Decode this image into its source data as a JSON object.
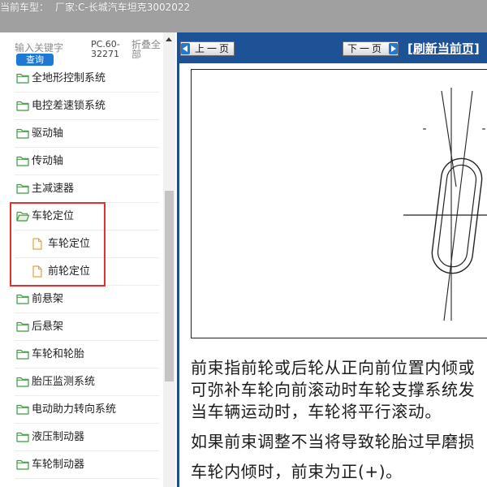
{
  "header": {
    "model_label": "当前车型：",
    "model_value": "厂家:C-长城汽车坦克3002022"
  },
  "sidebar": {
    "search": {
      "placeholder": "输入关键字",
      "button_label": "查询"
    },
    "model_code": "PC.60-32271",
    "collapse_all_label": "折叠全部",
    "tree": [
      {
        "label": "全地形控制系统",
        "icon": "folder-icon",
        "level": 1
      },
      {
        "label": "电控差速锁系统",
        "icon": "folder-icon",
        "level": 1
      },
      {
        "label": "驱动轴",
        "icon": "folder-icon",
        "level": 1
      },
      {
        "label": "传动轴",
        "icon": "folder-icon",
        "level": 1
      },
      {
        "label": "主减速器",
        "icon": "folder-icon",
        "level": 1
      },
      {
        "label": "车轮定位",
        "icon": "folder-open-icon",
        "level": 1,
        "expanded": true,
        "highlighted": true
      },
      {
        "label": "车轮定位",
        "icon": "document-icon",
        "level": 2,
        "highlighted": true
      },
      {
        "label": "前轮定位",
        "icon": "document-icon",
        "level": 2,
        "highlighted": true
      },
      {
        "label": "前悬架",
        "icon": "folder-icon",
        "level": 1
      },
      {
        "label": "后悬架",
        "icon": "folder-icon",
        "level": 1
      },
      {
        "label": "车轮和轮胎",
        "icon": "folder-icon",
        "level": 1
      },
      {
        "label": "胎压监测系统",
        "icon": "folder-icon",
        "level": 1
      },
      {
        "label": "电动助力转向系统",
        "icon": "folder-icon",
        "level": 1
      },
      {
        "label": "液压制动器",
        "icon": "folder-icon",
        "level": 1
      },
      {
        "label": "车轮制动器",
        "icon": "folder-icon",
        "level": 1
      }
    ]
  },
  "nav": {
    "prev_label": "上一页",
    "next_label": "下一页",
    "refresh_label": "[刷新当前页]"
  },
  "content": {
    "figure": {
      "marks": [
        "-",
        "-"
      ]
    },
    "paragraphs": [
      {
        "lines": [
          "前束指前轮或后轮从正向前位置内倾或",
          "可弥补车轮向前滚动时车轮支撑系统发",
          "当车辆运动时，车轮将平行滚动。"
        ]
      },
      {
        "lines": [
          "如果前束调整不当将导致轮胎过早磨损"
        ]
      },
      {
        "lines": [
          "车轮内倾时，前束为正(+)。"
        ]
      }
    ]
  },
  "colors": {
    "header_bg": "#a0a0a0",
    "nav_bg": "#1d5297",
    "nav_border": "#1f4f8f",
    "accent_blue": "#1f78d1",
    "highlight_red": "#e23030",
    "folder_green": "#3f9b3f",
    "doc_orange": "#e9a13a"
  }
}
